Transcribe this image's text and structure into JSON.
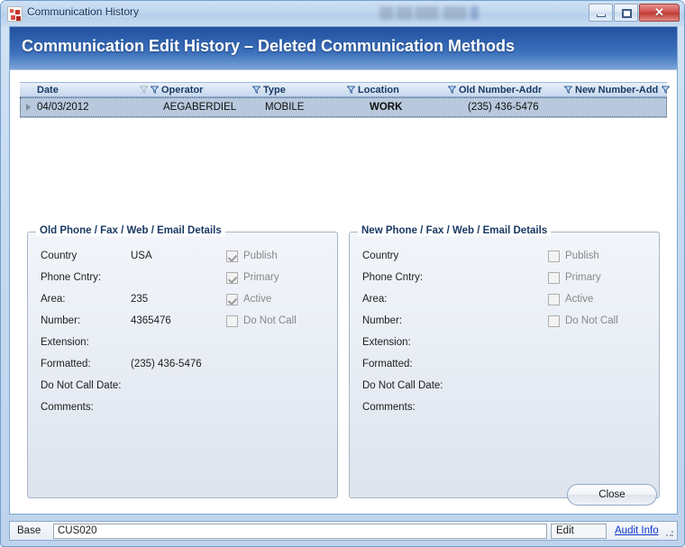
{
  "window": {
    "title": "Communication History",
    "icon": "app-icon",
    "controls": {
      "minimize": "minimize-button",
      "restore": "restore-button",
      "close": "✕"
    }
  },
  "banner": {
    "title": "Communication Edit History – Deleted Communication Methods",
    "background_start": "#23519d",
    "background_end": "#7ba4d8"
  },
  "grid": {
    "columns": [
      {
        "key": "date",
        "label": "Date",
        "filters": []
      },
      {
        "key": "oper",
        "label": "Operator",
        "filters": [
          "grey",
          "blue"
        ]
      },
      {
        "key": "type",
        "label": "Type",
        "filters": [
          "blue"
        ]
      },
      {
        "key": "loc",
        "label": "Location",
        "filters": [
          "blue"
        ]
      },
      {
        "key": "old",
        "label": "Old Number-Addr",
        "filters": [
          "blue"
        ]
      },
      {
        "key": "new",
        "label": "New Number-Add",
        "filters": [
          "blue"
        ]
      }
    ],
    "rows": [
      {
        "date": "04/03/2012",
        "operator": "AEGABERDIEL",
        "type": "MOBILE",
        "location": "WORK",
        "old_number": "(235) 436-5476",
        "new_number": ""
      }
    ],
    "selected_row_color": "#b8c9dd"
  },
  "old_details": {
    "legend": "Old Phone / Fax / Web / Email Details",
    "fields": [
      {
        "label": "Country",
        "value": "USA"
      },
      {
        "label": "Phone Cntry:",
        "value": ""
      },
      {
        "label": "Area:",
        "value": "235"
      },
      {
        "label": "Number:",
        "value": "4365476"
      },
      {
        "label": "Extension:",
        "value": ""
      },
      {
        "label": "Formatted:",
        "value": "(235) 436-5476"
      },
      {
        "label": "Do Not Call Date:",
        "value": ""
      },
      {
        "label": "Comments:",
        "value": ""
      }
    ],
    "checkboxes": [
      {
        "label": "Publish",
        "checked": true
      },
      {
        "label": "Primary",
        "checked": true
      },
      {
        "label": "Active",
        "checked": true
      },
      {
        "label": "Do Not Call",
        "checked": false
      }
    ]
  },
  "new_details": {
    "legend": "New Phone / Fax / Web / Email Details",
    "fields": [
      {
        "label": "Country",
        "value": ""
      },
      {
        "label": "Phone Cntry:",
        "value": ""
      },
      {
        "label": "Area:",
        "value": ""
      },
      {
        "label": "Number:",
        "value": ""
      },
      {
        "label": "Extension:",
        "value": ""
      },
      {
        "label": "Formatted:",
        "value": ""
      },
      {
        "label": "Do Not Call Date:",
        "value": ""
      },
      {
        "label": "Comments:",
        "value": ""
      }
    ],
    "checkboxes": [
      {
        "label": "Publish",
        "checked": false
      },
      {
        "label": "Primary",
        "checked": false
      },
      {
        "label": "Active",
        "checked": false
      },
      {
        "label": "Do Not Call",
        "checked": false
      }
    ]
  },
  "footer": {
    "close_label": "Close"
  },
  "statusbar": {
    "base_label": "Base",
    "base_value": "CUS020",
    "edit_label": "Edit",
    "audit_link": "Audit Info",
    "link_color": "#0b36c8"
  }
}
